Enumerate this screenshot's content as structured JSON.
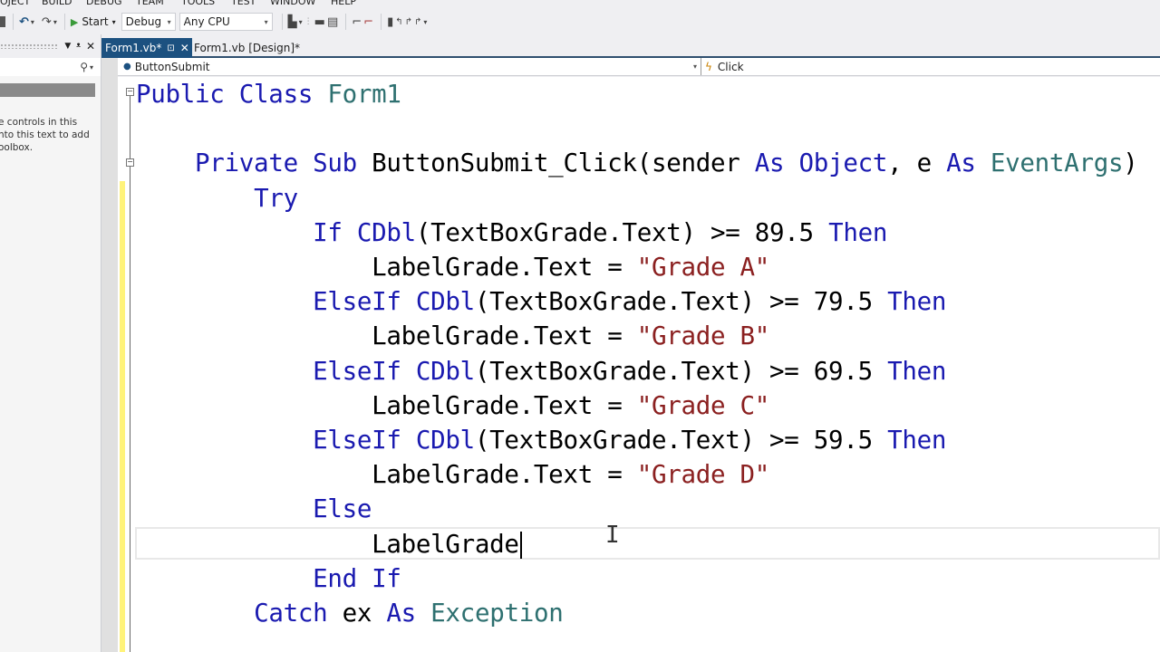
{
  "menu": [
    "OJECT",
    "BUILD",
    "DEBUG",
    "TEAM",
    "TOOLS",
    "TEST",
    "WINDOW",
    "HELP"
  ],
  "toolbar": {
    "start_label": "Start",
    "config_value": "Debug",
    "platform_value": "Any CPU"
  },
  "left_panel": {
    "hint_text": "e controls in this\nnto this text to add\noolbox."
  },
  "tabs": [
    {
      "label": "Form1.vb*",
      "active": true
    },
    {
      "label": "Form1.vb [Design]*",
      "active": false
    }
  ],
  "navbar": {
    "object": "ButtonSubmit",
    "event": "Click"
  },
  "code": {
    "lines": [
      [
        [
          "kw",
          "Public Class "
        ],
        [
          "ty",
          "Form1"
        ]
      ],
      [],
      [
        [
          "",
          "    "
        ],
        [
          "kw",
          "Private Sub "
        ],
        [
          "",
          "ButtonSubmit_Click(sender "
        ],
        [
          "kw",
          "As Object"
        ],
        [
          "",
          ", e "
        ],
        [
          "kw",
          "As "
        ],
        [
          "ty",
          "EventArgs"
        ],
        [
          "",
          ")"
        ]
      ],
      [
        [
          "",
          "        "
        ],
        [
          "kw",
          "Try"
        ]
      ],
      [
        [
          "",
          "            "
        ],
        [
          "kw",
          "If CDbl"
        ],
        [
          "",
          "(TextBoxGrade.Text) >= 89.5 "
        ],
        [
          "kw",
          "Then"
        ]
      ],
      [
        [
          "",
          "                LabelGrade.Text = "
        ],
        [
          "str",
          "\"Grade A\""
        ]
      ],
      [
        [
          "",
          "            "
        ],
        [
          "kw",
          "ElseIf CDbl"
        ],
        [
          "",
          "(TextBoxGrade.Text) >= 79.5 "
        ],
        [
          "kw",
          "Then"
        ]
      ],
      [
        [
          "",
          "                LabelGrade.Text = "
        ],
        [
          "str",
          "\"Grade B\""
        ]
      ],
      [
        [
          "",
          "            "
        ],
        [
          "kw",
          "ElseIf CDbl"
        ],
        [
          "",
          "(TextBoxGrade.Text) >= 69.5 "
        ],
        [
          "kw",
          "Then"
        ]
      ],
      [
        [
          "",
          "                LabelGrade.Text = "
        ],
        [
          "str",
          "\"Grade C\""
        ]
      ],
      [
        [
          "",
          "            "
        ],
        [
          "kw",
          "ElseIf CDbl"
        ],
        [
          "",
          "(TextBoxGrade.Text) >= 59.5 "
        ],
        [
          "kw",
          "Then"
        ]
      ],
      [
        [
          "",
          "                LabelGrade.Text = "
        ],
        [
          "str",
          "\"Grade D\""
        ]
      ],
      [
        [
          "",
          "            "
        ],
        [
          "kw",
          "Else"
        ]
      ],
      [
        [
          "",
          "                LabelGrade"
        ]
      ],
      [
        [
          "",
          "            "
        ],
        [
          "kw",
          "End If"
        ]
      ],
      [
        [
          "",
          "        "
        ],
        [
          "kw",
          "Catch "
        ],
        [
          "",
          "ex "
        ],
        [
          "kw",
          "As "
        ],
        [
          "ty",
          "Exception"
        ]
      ]
    ],
    "current_line": 13
  }
}
